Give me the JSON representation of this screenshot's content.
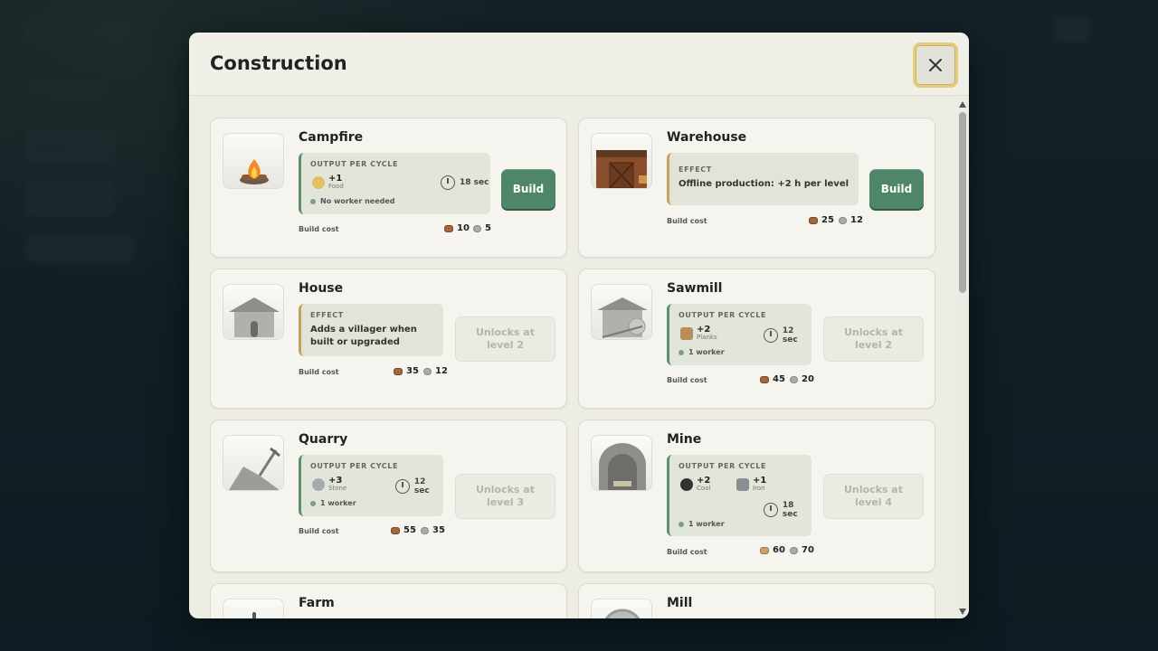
{
  "modal": {
    "title": "Construction"
  },
  "common": {
    "output_header": "OUTPUT PER CYCLE",
    "effect_header": "EFFECT",
    "build_cost_label": "Build cost",
    "build_label": "Build"
  },
  "cards": {
    "campfire": {
      "name": "Campfire",
      "out1_value": "+1",
      "out1_label": "Food",
      "time": "18 sec",
      "worker": "No worker needed",
      "cost_wood": "10",
      "cost_stone": "5"
    },
    "warehouse": {
      "name": "Warehouse",
      "effect": "Offline production: +2 h per level",
      "cost_wood": "25",
      "cost_stone": "12"
    },
    "house": {
      "name": "House",
      "effect": "Adds a villager when built or upgraded",
      "cost_wood": "35",
      "cost_stone": "12",
      "lock": "Unlocks at level 2"
    },
    "sawmill": {
      "name": "Sawmill",
      "out1_value": "+2",
      "out1_label": "Planks",
      "time": "12 sec",
      "worker": "1 worker",
      "cost_wood": "45",
      "cost_stone": "20",
      "lock": "Unlocks at level 2"
    },
    "quarry": {
      "name": "Quarry",
      "out1_value": "+3",
      "out1_label": "Stone",
      "time": "12 sec",
      "worker": "1 worker",
      "cost_wood": "55",
      "cost_stone": "35",
      "lock": "Unlocks at level 3"
    },
    "mine": {
      "name": "Mine",
      "out1_value": "+2",
      "out1_label": "Coal",
      "out2_value": "+1",
      "out2_label": "Iron",
      "time": "18 sec",
      "worker": "1 worker",
      "cost_planks": "60",
      "cost_stone": "70",
      "lock": "Unlocks at level 4"
    },
    "farm": {
      "name": "Farm"
    },
    "mill": {
      "name": "Mill"
    }
  },
  "colors": {
    "build_button": "#4f8569",
    "accent_green": "#5f8f6f",
    "accent_gold": "#c2a45e",
    "close_outline": "#e6cd7a"
  }
}
